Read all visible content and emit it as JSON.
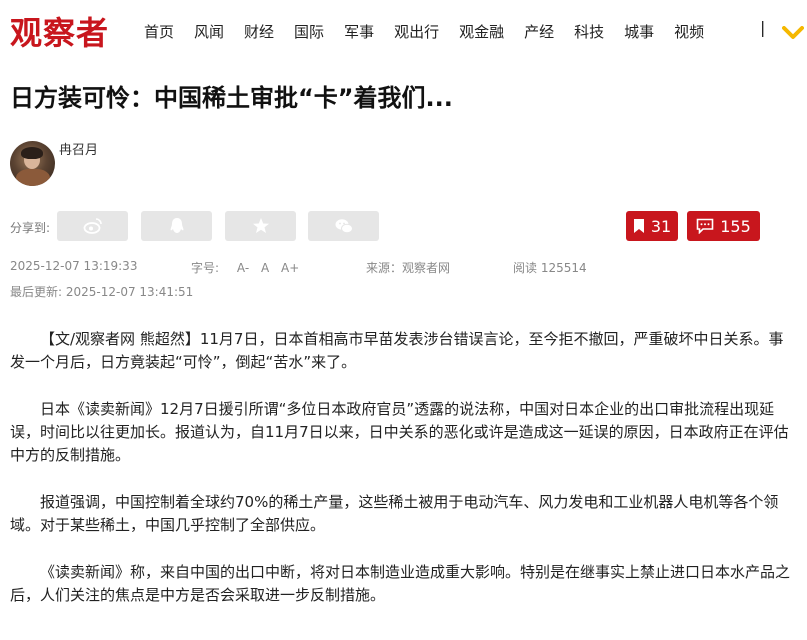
{
  "site": {
    "logo_text": "观察者"
  },
  "nav": {
    "items": [
      "首页",
      "风闻",
      "财经",
      "国际",
      "军事",
      "观出行",
      "观金融",
      "产经",
      "科技",
      "城事",
      "视频"
    ],
    "separator": "|"
  },
  "article": {
    "title": "日方装可怜：中国稀土审批“卡”着我们...",
    "author": "冉召月",
    "share_label": "分享到:",
    "share_icons": [
      "weibo-icon",
      "qq-icon",
      "qzone-icon",
      "wechat-icon"
    ],
    "bookmark_count": "31",
    "comment_count": "155",
    "published": "2025-12-07 13:19:33",
    "font_label": "字号:",
    "font_options": [
      "A-",
      "A",
      "A+"
    ],
    "source": "来源：观察者网",
    "reads": "阅读 125514",
    "updated": "最后更新: 2025-12-07 13:41:51",
    "paragraphs": [
      "【文/观察者网 熊超然】11月7日，日本首相高市早苗发表涉台错误言论，至今拒不撤回，严重破坏中日关系。事发一个月后，日方竟装起“可怜”，倒起“苦水”来了。",
      "日本《读卖新闻》12月7日援引所谓“多位日本政府官员”透露的说法称，中国对日本企业的出口审批流程出现延误，时间比以往更加长。报道认为，自11月7日以来，日中关系的恶化或许是造成这一延误的原因，日本政府正在评估中方的反制措施。",
      "报道强调，中国控制着全球约70%的稀土产量，这些稀土被用于电动汽车、风力发电和工业机器人电机等各个领域。对于某些稀土，中国几乎控制了全部供应。",
      "《读卖新闻》称，来自中国的出口中断，将对日本制造业造成重大影响。特别是在继事实上禁止进口日本水产品之后，人们关注的焦点是中方是否会采取进一步反制措施。"
    ]
  },
  "colors": {
    "brand": "#c8161d",
    "accent_yellow": "#f5b800",
    "share_bg": "#e6e6e6"
  }
}
